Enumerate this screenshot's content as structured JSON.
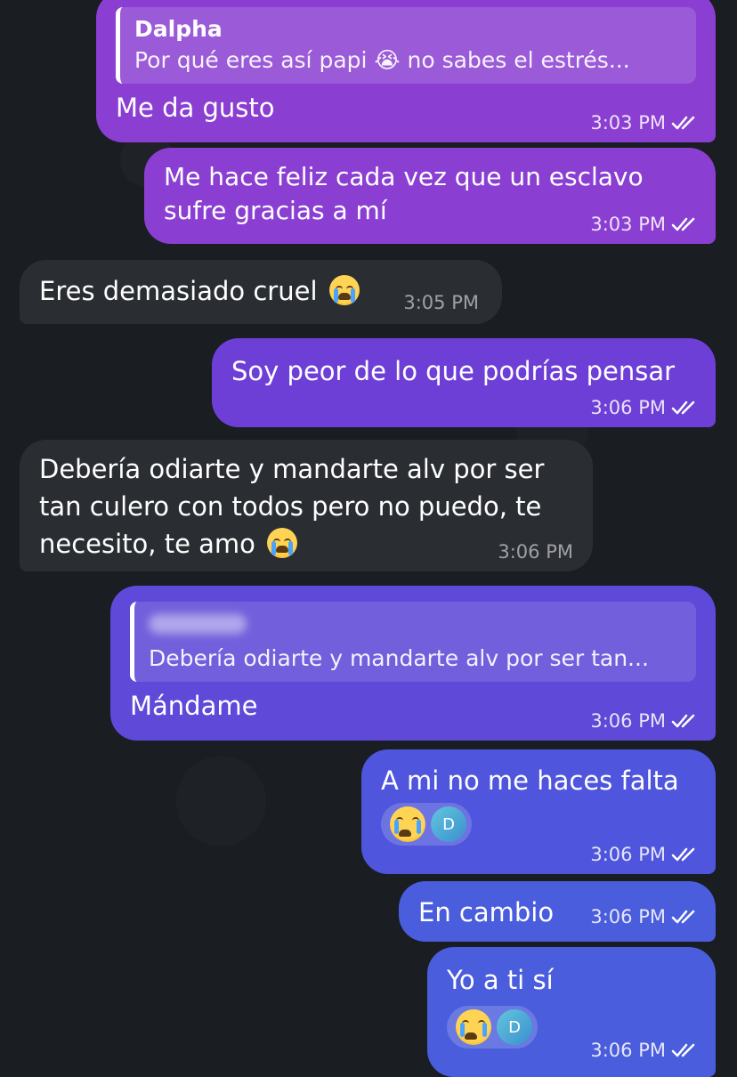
{
  "messages": [
    {
      "quote_name": "Dalpha",
      "quote_text": "Por qué eres así papi 😭 no sabes el estrés...",
      "text": "Me da gusto",
      "time": "3:03 PM"
    },
    {
      "text": "Me hace feliz cada vez que un esclavo\nsufre gracias a mí",
      "time": "3:03 PM"
    },
    {
      "text": "Eres demasiado cruel",
      "time": "3:05 PM"
    },
    {
      "text": "Soy peor de lo que podrías pensar",
      "time": "3:06 PM"
    },
    {
      "text": "Debería odiarte y mandarte alv por ser\ntan culero con todos pero no puedo, te\nnecesito, te amo",
      "time": "3:06 PM"
    },
    {
      "quote_text": "Debería odiarte y mandarte alv por ser tan...",
      "text": "Mándame",
      "time": "3:06 PM"
    },
    {
      "text": "A mi no me haces falta",
      "reaction_avatar": "D",
      "time": "3:06 PM"
    },
    {
      "text": "En cambio",
      "time": "3:06 PM"
    },
    {
      "text": "Yo a ti sí",
      "reaction_avatar": "D",
      "time": "3:06 PM"
    }
  ],
  "icons": {
    "read_receipt": "double-check-icon",
    "crying_emoji": "loudly-crying-face-emoji"
  },
  "colors": {
    "background": "#1a1d22",
    "incoming": "#2a2d32",
    "outgoing_top": "#8b3fd2",
    "outgoing_bottom": "#4a5ddc"
  }
}
